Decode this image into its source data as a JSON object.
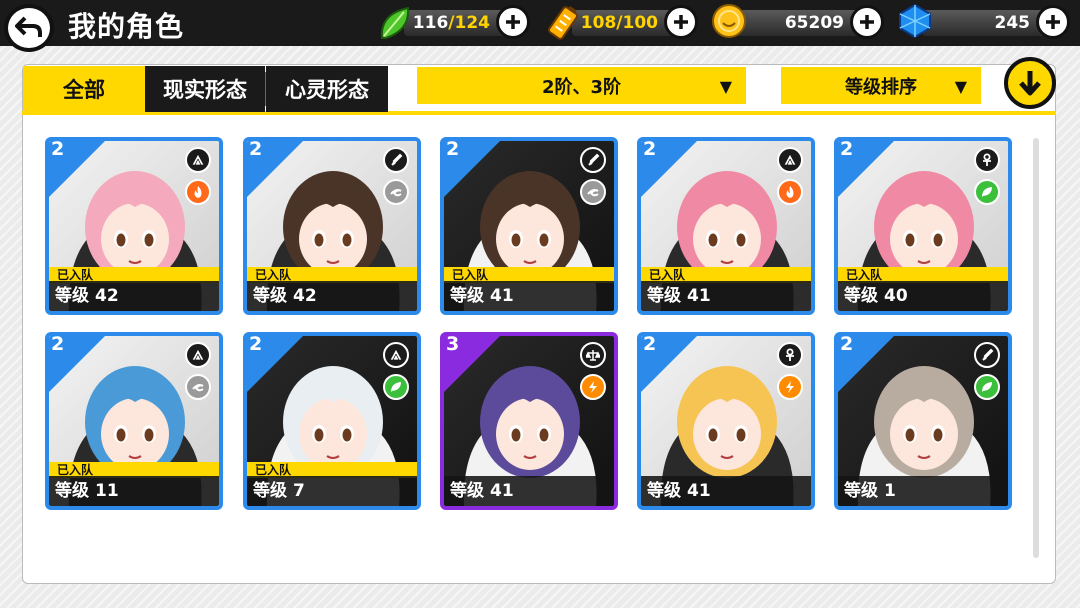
{
  "header": {
    "title": "我的角色"
  },
  "resources": [
    {
      "name": "stamina",
      "current": "116",
      "max": "/124",
      "icon": "green-leaf-icon"
    },
    {
      "name": "energy",
      "current": "108",
      "max": "/100",
      "icon": "battery-icon"
    },
    {
      "name": "gold",
      "value": "65209",
      "icon": "gold-coin-icon"
    },
    {
      "name": "diamonds",
      "value": "245",
      "icon": "blue-crystal-icon"
    }
  ],
  "tabs": [
    {
      "label": "全部",
      "active": true
    },
    {
      "label": "现实形态",
      "active": false
    },
    {
      "label": "心灵形态",
      "active": false
    }
  ],
  "filters": {
    "rank": {
      "label": "2阶、3阶",
      "arrow": "▼"
    },
    "sort": {
      "label": "等级排序",
      "arrow": "▼"
    }
  },
  "colors": {
    "accent": "#ffd800",
    "dark": "#1a1a1a",
    "blue_frame": "#2c8bea",
    "purple_frame": "#8a2be0"
  },
  "characters": [
    {
      "rank": "2",
      "role": "triforce",
      "element": "fire",
      "in_party": "已入队",
      "level_label": "等级",
      "level": "42",
      "hair": "#f4a9bc",
      "frame": "blue"
    },
    {
      "rank": "2",
      "role": "sword",
      "element": "wind",
      "in_party": "已入队",
      "level_label": "等级",
      "level": "42",
      "hair": "#4a3428",
      "frame": "blue"
    },
    {
      "rank": "2",
      "role": "sword",
      "element": "wind",
      "in_party": "已入队",
      "level_label": "等级",
      "level": "41",
      "hair": "#4a3428",
      "frame": "blue"
    },
    {
      "rank": "2",
      "role": "triforce",
      "element": "fire",
      "in_party": "已入队",
      "level_label": "等级",
      "level": "41",
      "hair": "#f08aa4",
      "frame": "blue"
    },
    {
      "rank": "2",
      "role": "ankh",
      "element": "leaf",
      "in_party": "已入队",
      "level_label": "等级",
      "level": "40",
      "hair": "#f08aa4",
      "frame": "blue"
    },
    {
      "rank": "2",
      "role": "triforce",
      "element": "wind",
      "in_party": "已入队",
      "level_label": "等级",
      "level": "11",
      "hair": "#4a9ad8",
      "frame": "blue"
    },
    {
      "rank": "2",
      "role": "triforce",
      "element": "leaf",
      "in_party": "已入队",
      "level_label": "等级",
      "level": "7",
      "hair": "#e8eef2",
      "frame": "blue"
    },
    {
      "rank": "3",
      "role": "scale",
      "element": "lightning",
      "in_party": "",
      "level_label": "等级",
      "level": "41",
      "hair": "#5c4a9a",
      "frame": "purple"
    },
    {
      "rank": "2",
      "role": "ankh",
      "element": "lightning",
      "in_party": "",
      "level_label": "等级",
      "level": "41",
      "hair": "#f5c453",
      "frame": "blue"
    },
    {
      "rank": "2",
      "role": "sword",
      "element": "leaf",
      "in_party": "",
      "level_label": "等级",
      "level": "1",
      "hair": "#b8aca0",
      "frame": "blue"
    }
  ]
}
